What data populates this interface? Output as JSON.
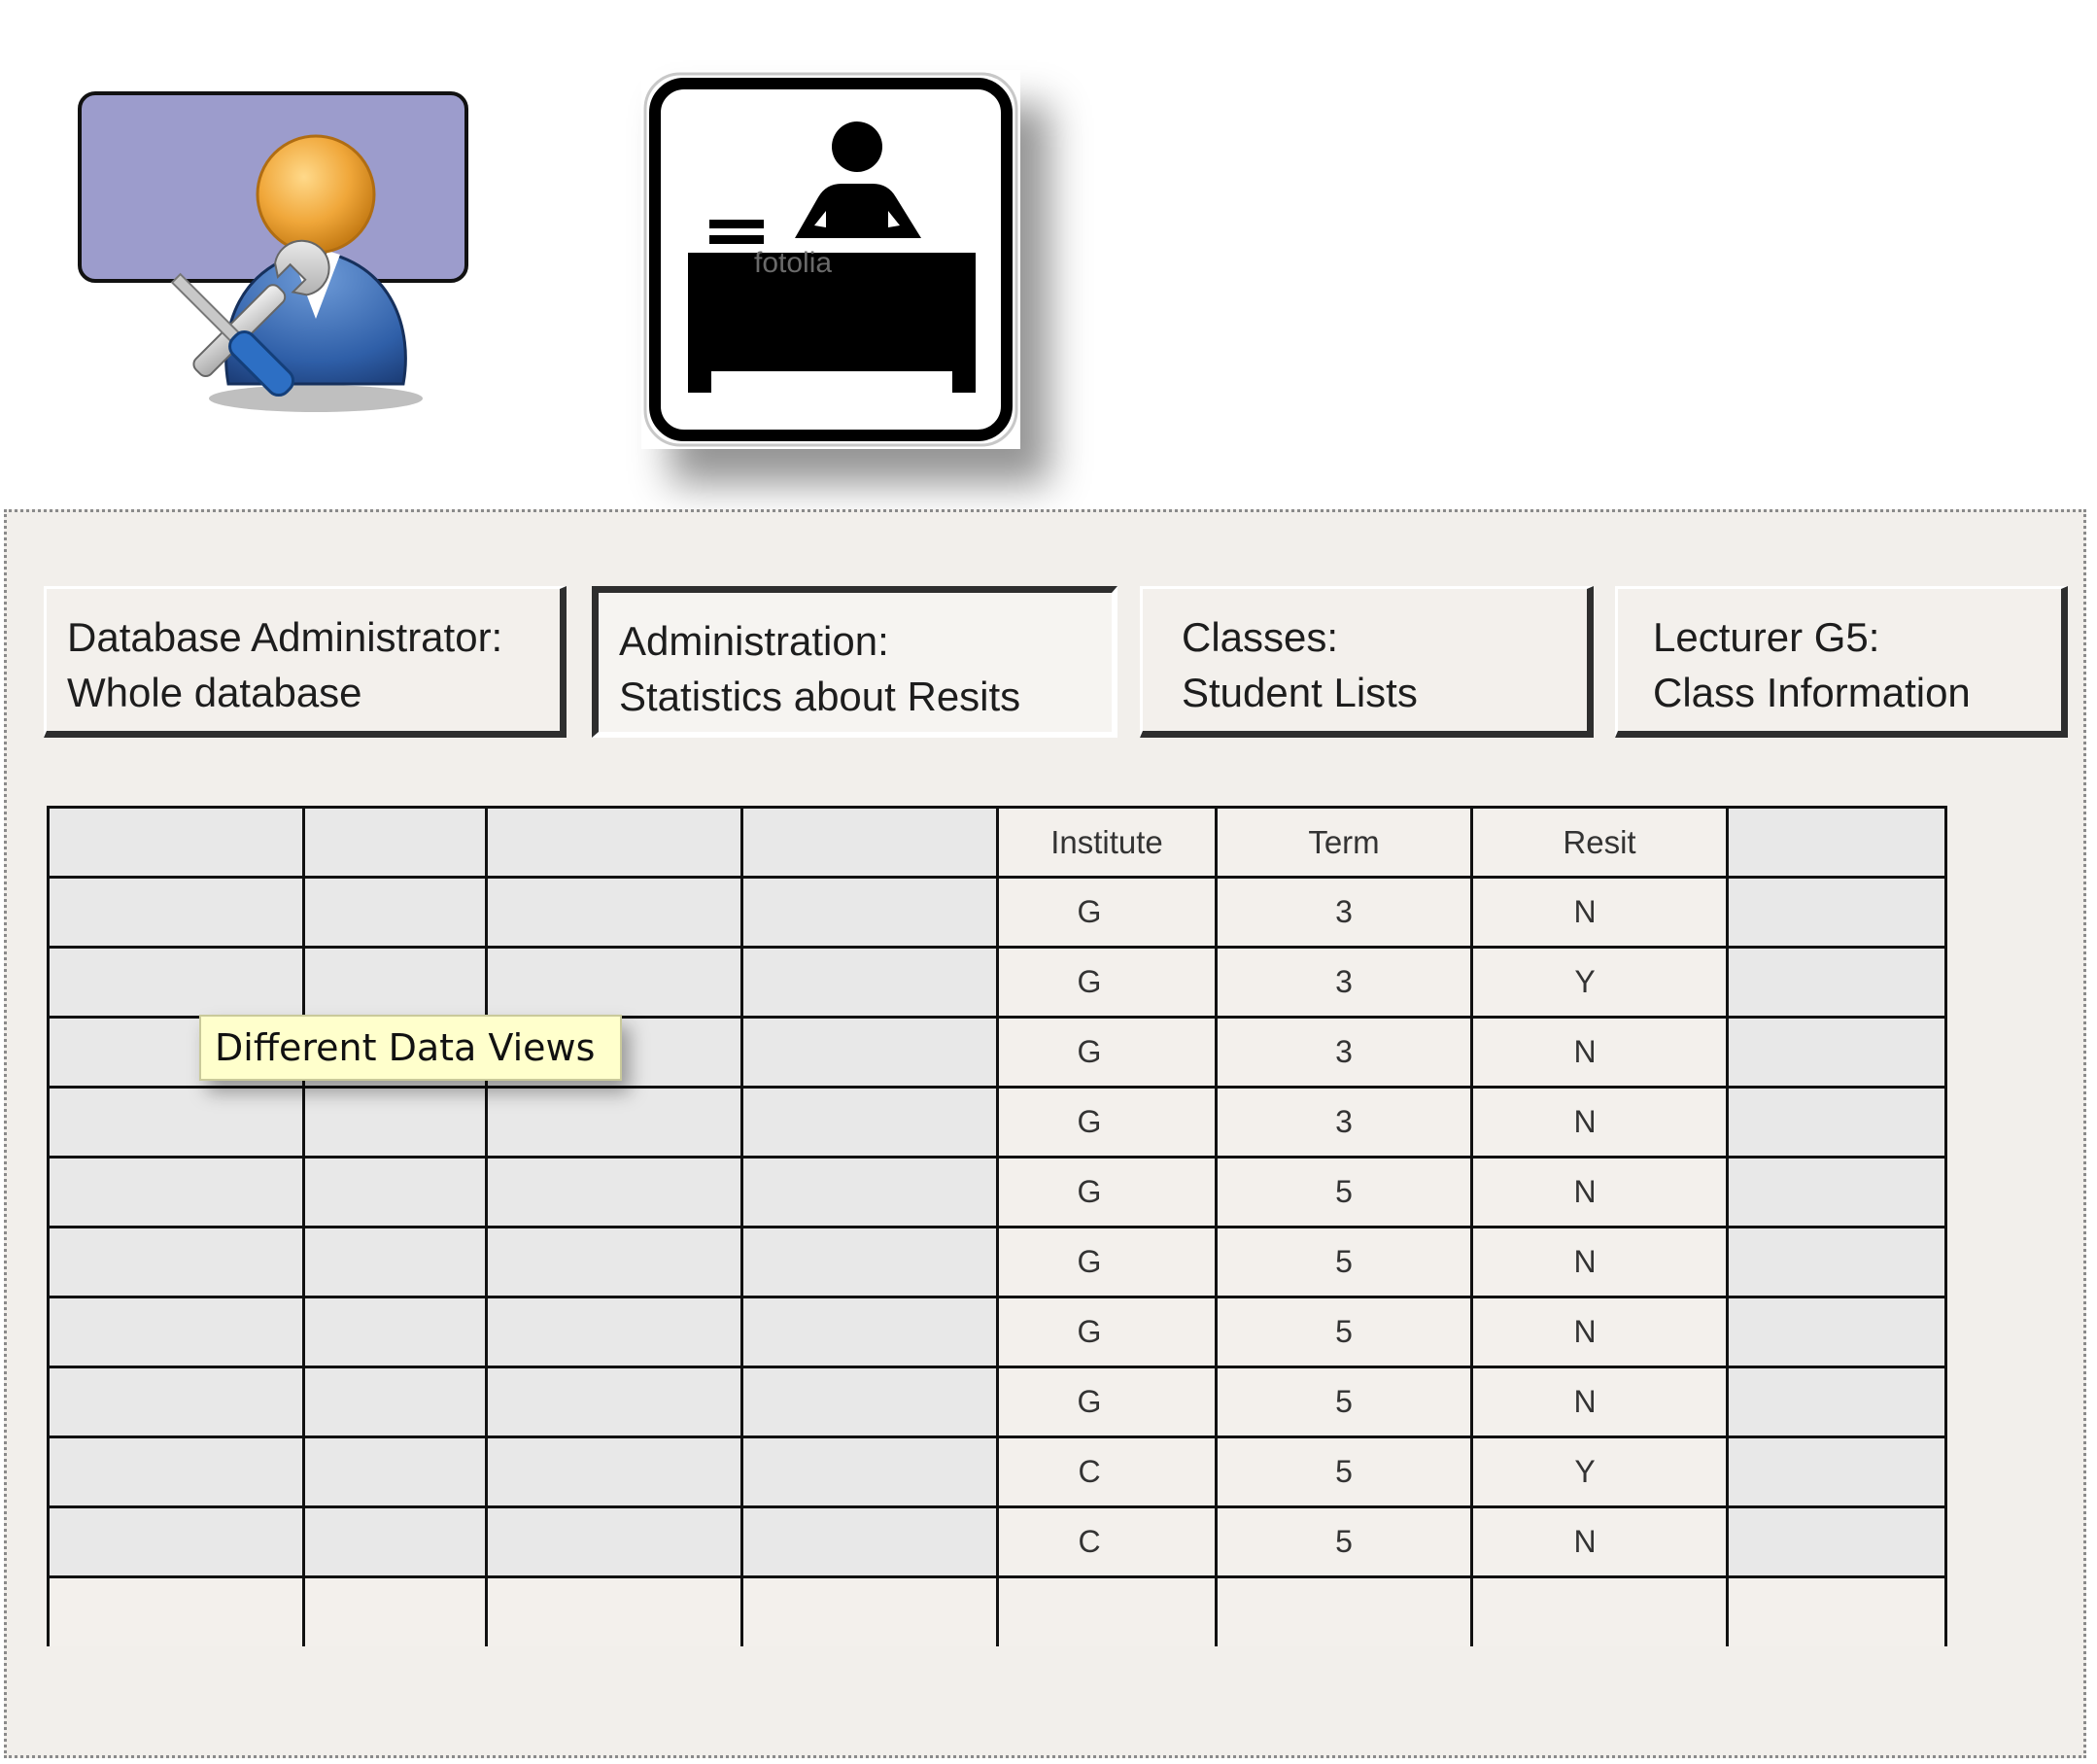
{
  "icons": {
    "admin": "database-administrator-icon",
    "desk": "desk-attendant-icon",
    "watermark": "fotolia"
  },
  "view_buttons": [
    {
      "line1": "Database Administrator:",
      "line2": "Whole database",
      "active": false
    },
    {
      "line1": "Administration:",
      "line2": "Statistics about Resits",
      "active": true
    },
    {
      "line1": "Classes:",
      "line2": "Student Lists",
      "active": false
    },
    {
      "line1": "Lecturer G5:",
      "line2": "Class Information",
      "active": false
    }
  ],
  "table": {
    "headers": [
      "",
      "",
      "",
      "",
      "Institute",
      "Term",
      "Resit",
      ""
    ],
    "rows": [
      [
        "G",
        "3",
        "N"
      ],
      [
        "G",
        "3",
        "Y"
      ],
      [
        "G",
        "3",
        "N"
      ],
      [
        "G",
        "3",
        "N"
      ],
      [
        "G",
        "5",
        "N"
      ],
      [
        "G",
        "5",
        "N"
      ],
      [
        "G",
        "5",
        "N"
      ],
      [
        "G",
        "5",
        "N"
      ],
      [
        "C",
        "5",
        "Y"
      ],
      [
        "C",
        "5",
        "N"
      ]
    ]
  },
  "tooltip": "Different Data Views",
  "colors": {
    "panel_bg": "#f2efeb",
    "empty_cell": "#e8e8e8",
    "admin_card": "#9c9ccc",
    "tooltip_bg": "#ffffcc"
  }
}
